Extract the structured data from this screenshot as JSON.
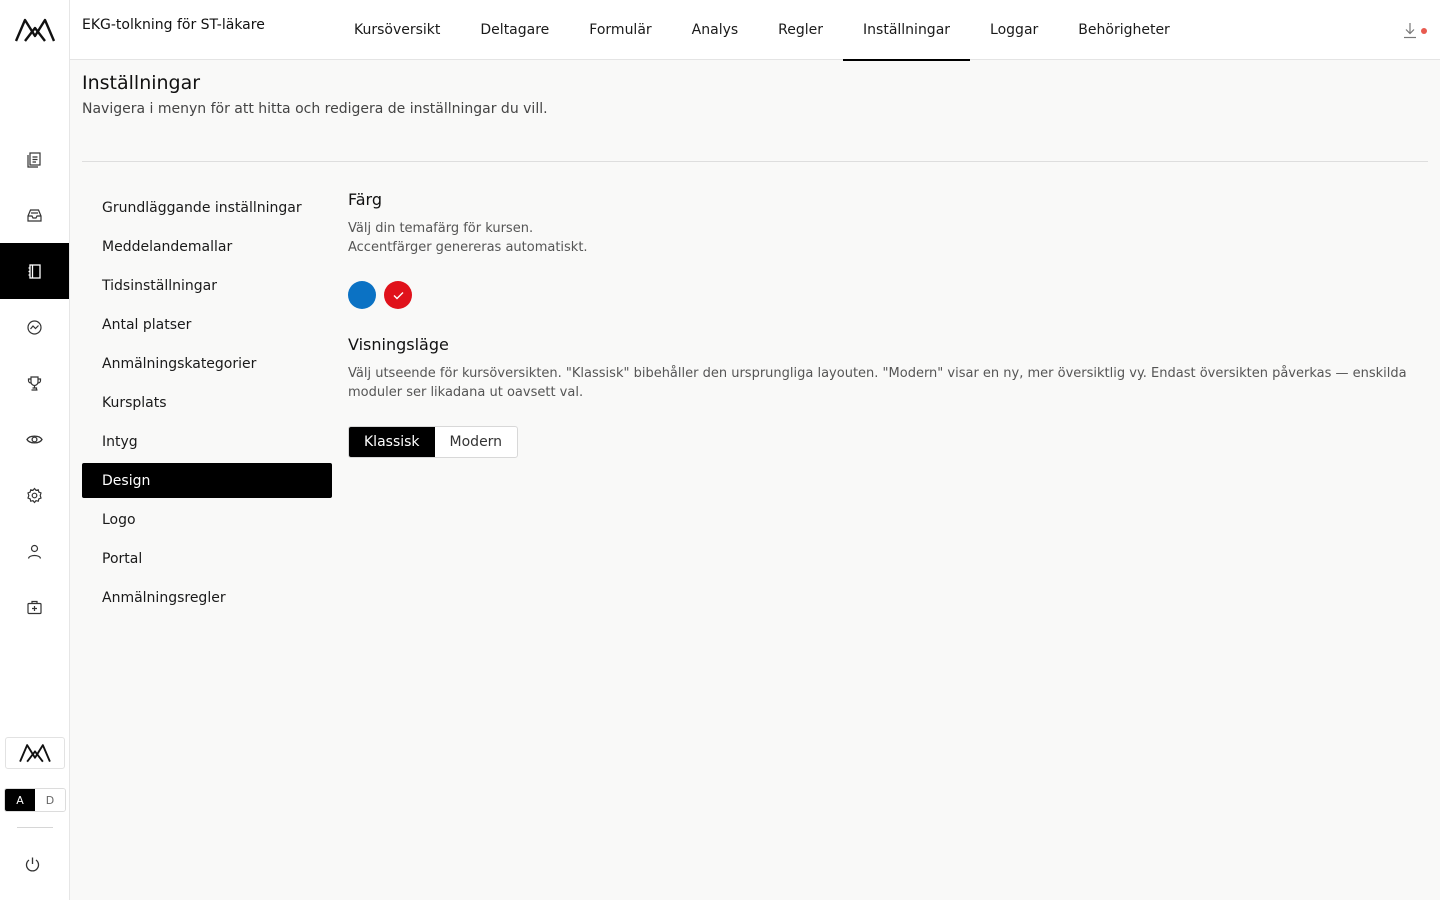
{
  "rail": {
    "items": [
      {
        "name": "courses-icon"
      },
      {
        "name": "inbox-icon"
      },
      {
        "name": "notebook-icon"
      },
      {
        "name": "analytics-icon"
      },
      {
        "name": "trophy-icon"
      },
      {
        "name": "eye-icon"
      },
      {
        "name": "gear-icon"
      },
      {
        "name": "user-icon"
      },
      {
        "name": "medical-kit-icon"
      }
    ],
    "active_index": 2,
    "mode_toggle": {
      "a": "A",
      "d": "D"
    }
  },
  "topbar": {
    "course_title": "EKG-tolkning för ST-läkare",
    "tabs": [
      "Kursöversikt",
      "Deltagare",
      "Formulär",
      "Analys",
      "Regler",
      "Inställningar",
      "Loggar",
      "Behörigheter"
    ],
    "active_tab": "Inställningar"
  },
  "header": {
    "title": "Inställningar",
    "subtitle": "Navigera i menyn för att hitta och redigera de inställningar du vill."
  },
  "settings_menu": {
    "items": [
      "Grundläggande inställningar",
      "Meddelandemallar",
      "Tidsinställningar",
      "Antal platser",
      "Anmälningskategorier",
      "Kursplats",
      "Intyg",
      "Design",
      "Logo",
      "Portal",
      "Anmälningsregler"
    ],
    "active": "Design"
  },
  "design": {
    "color": {
      "title": "Färg",
      "line1": "Välj din temafärg för kursen.",
      "line2": "Accentfärger genereras automatiskt.",
      "swatches": [
        {
          "color": "#0b72c4",
          "selected": false
        },
        {
          "color": "#e0121b",
          "selected": true
        }
      ]
    },
    "view_mode": {
      "title": "Visningsläge",
      "text": "Välj utseende för kursöversikten. \"Klassisk\" bibehåller den ursprungliga layouten. \"Modern\" visar en ny, mer översiktlig vy. Endast översikten påverkas — enskilda moduler ser likadana ut oavsett val.",
      "options": [
        "Klassisk",
        "Modern"
      ],
      "selected": "Klassisk"
    }
  },
  "colors": {
    "accent_dark": "#000000",
    "notification_dot": "#e85a4f"
  }
}
